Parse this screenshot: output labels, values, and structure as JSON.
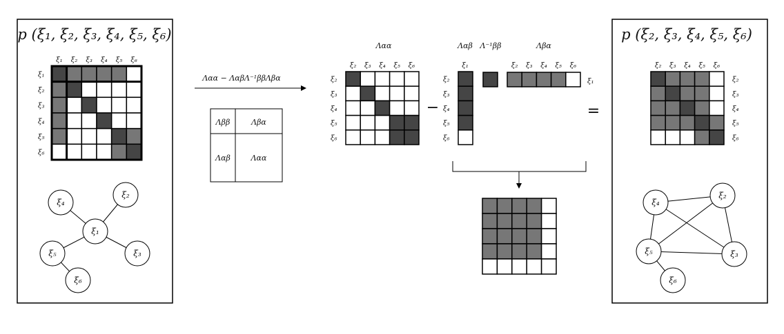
{
  "colors": {
    "dark": "#454545",
    "medium": "#777777",
    "empty": "#ffffff",
    "line": "#000000"
  },
  "left_panel": {
    "title": "p (ξ₁, ξ₂, ξ₃, ξ₄, ξ₅, ξ₆)",
    "col_labels": [
      "ξ₁",
      "ξ₂",
      "ξ₃",
      "ξ₄",
      "ξ₅",
      "ξ₆"
    ],
    "row_labels": [
      "ξ₁",
      "ξ₂",
      "ξ₃",
      "ξ₄",
      "ξ₅",
      "ξ₆"
    ],
    "matrix": [
      [
        "d",
        "m",
        "m",
        "m",
        "m",
        "e"
      ],
      [
        "m",
        "d",
        "e",
        "e",
        "e",
        "e"
      ],
      [
        "m",
        "e",
        "d",
        "e",
        "e",
        "e"
      ],
      [
        "m",
        "e",
        "e",
        "d",
        "e",
        "e"
      ],
      [
        "m",
        "e",
        "e",
        "e",
        "d",
        "m"
      ],
      [
        "e",
        "e",
        "e",
        "e",
        "m",
        "d"
      ]
    ],
    "graph": {
      "nodes": [
        "ξ₁",
        "ξ₂",
        "ξ₃",
        "ξ₄",
        "ξ₅",
        "ξ₆"
      ],
      "edges": [
        [
          "ξ₁",
          "ξ₂"
        ],
        [
          "ξ₁",
          "ξ₃"
        ],
        [
          "ξ₁",
          "ξ₄"
        ],
        [
          "ξ₁",
          "ξ₅"
        ],
        [
          "ξ₅",
          "ξ₆"
        ]
      ]
    }
  },
  "transform": {
    "formula": "Λαα − ΛαβΛ⁻¹ββΛβα",
    "block_labels": [
      "Λββ",
      "Λβα",
      "Λαβ",
      "Λαα"
    ]
  },
  "middle": {
    "aa_header": "Λαα",
    "ab_header": "Λαβ",
    "bb_inv_header": "Λ⁻¹ββ",
    "ba_header": "Λβα",
    "aa_col_labels": [
      "ξ₂",
      "ξ₃",
      "ξ₄",
      "ξ₅",
      "ξ₆"
    ],
    "aa_row_labels": [
      "ξ₂",
      "ξ₃",
      "ξ₄",
      "ξ₅",
      "ξ₆"
    ],
    "aa_matrix": [
      [
        "d",
        "e",
        "e",
        "e",
        "e"
      ],
      [
        "e",
        "d",
        "e",
        "e",
        "e"
      ],
      [
        "e",
        "e",
        "d",
        "e",
        "e"
      ],
      [
        "e",
        "e",
        "e",
        "d",
        "d"
      ],
      [
        "e",
        "e",
        "e",
        "d",
        "d"
      ]
    ],
    "minus": "−",
    "ab_col_label": "ξ₁",
    "ab_row_labels": [
      "ξ₂",
      "ξ₃",
      "ξ₄",
      "ξ₅",
      "ξ₆"
    ],
    "ab_vector": [
      "d",
      "d",
      "d",
      "d",
      "e"
    ],
    "bb_inv_cell": "d",
    "ba_col_labels": [
      "ξ₂",
      "ξ₃",
      "ξ₄",
      "ξ₅",
      "ξ₆"
    ],
    "ba_row_label": "ξ₁",
    "ba_vector": [
      "m",
      "m",
      "m",
      "m",
      "e"
    ],
    "equals": "=",
    "product_matrix": [
      [
        "m",
        "m",
        "m",
        "m",
        "e"
      ],
      [
        "m",
        "m",
        "m",
        "m",
        "e"
      ],
      [
        "m",
        "m",
        "m",
        "m",
        "e"
      ],
      [
        "m",
        "m",
        "m",
        "m",
        "e"
      ],
      [
        "e",
        "e",
        "e",
        "e",
        "e"
      ]
    ]
  },
  "right_panel": {
    "title": "p (ξ₂, ξ₃, ξ₄, ξ₅, ξ₆)",
    "col_labels": [
      "ξ₂",
      "ξ₃",
      "ξ₄",
      "ξ₅",
      "ξ₆"
    ],
    "row_labels": [
      "ξ₂",
      "ξ₃",
      "ξ₄",
      "ξ₅",
      "ξ₆"
    ],
    "matrix": [
      [
        "d",
        "m",
        "m",
        "m",
        "e"
      ],
      [
        "m",
        "d",
        "m",
        "m",
        "e"
      ],
      [
        "m",
        "m",
        "d",
        "m",
        "e"
      ],
      [
        "m",
        "m",
        "m",
        "d",
        "m"
      ],
      [
        "e",
        "e",
        "e",
        "m",
        "d"
      ]
    ],
    "graph": {
      "nodes": [
        "ξ₂",
        "ξ₃",
        "ξ₄",
        "ξ₅",
        "ξ₆"
      ],
      "edges": [
        [
          "ξ₄",
          "ξ₂"
        ],
        [
          "ξ₄",
          "ξ₃"
        ],
        [
          "ξ₄",
          "ξ₅"
        ],
        [
          "ξ₂",
          "ξ₅"
        ],
        [
          "ξ₂",
          "ξ₃"
        ],
        [
          "ξ₅",
          "ξ₃"
        ],
        [
          "ξ₅",
          "ξ₆"
        ]
      ]
    }
  }
}
